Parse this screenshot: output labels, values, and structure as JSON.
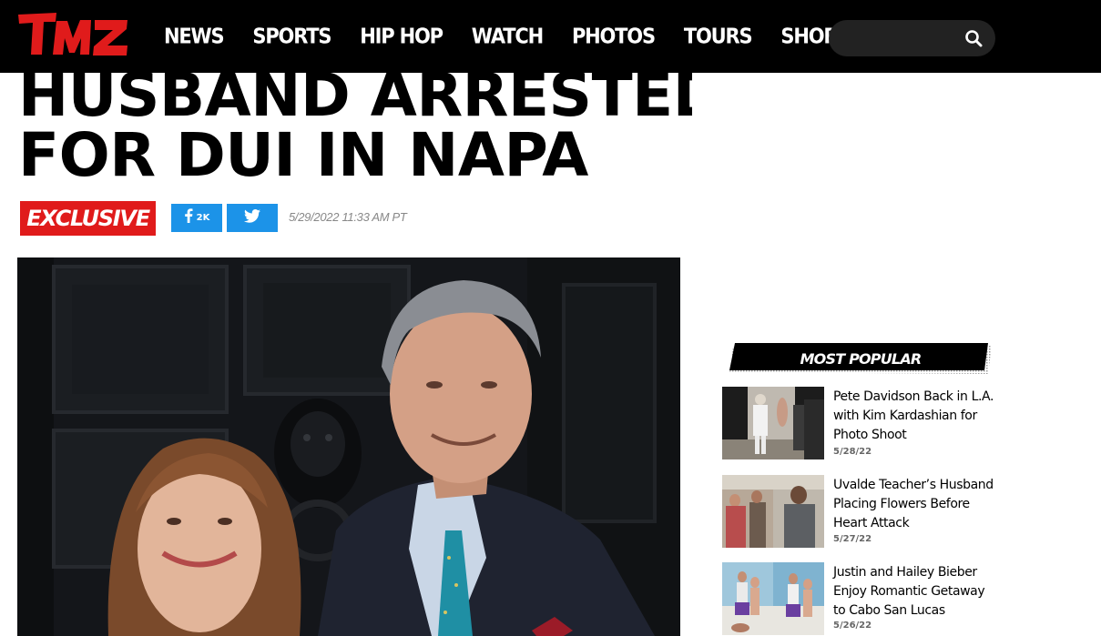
{
  "header": {
    "logo_text": "TMZ",
    "nav": [
      "NEWS",
      "SPORTS",
      "HIP HOP",
      "WATCH",
      "PHOTOS",
      "TOURS",
      "SHOP"
    ],
    "search": {
      "placeholder": "",
      "value": ""
    }
  },
  "article": {
    "headline_lines": [
      "HUSBAND ARRESTED",
      "FOR DUI IN NAPA"
    ],
    "badge": "EXCLUSIVE",
    "share": {
      "facebook_count": "2K"
    },
    "timestamp": "5/29/2022 11:33 AM PT"
  },
  "sidebar": {
    "most_popular_title": "MOST POPULAR",
    "items": [
      {
        "title": "Pete Davidson Back in L.A. with Kim Kardashian for Photo Shoot",
        "date": "5/28/22"
      },
      {
        "title": "Uvalde Teacher’s Husband Placing Flowers Before Heart Attack",
        "date": "5/27/22"
      },
      {
        "title": "Justin and Hailey Bieber Enjoy Romantic Getaway to Cabo San Lucas",
        "date": "5/26/22"
      }
    ]
  },
  "colors": {
    "header_bg": "#000000",
    "brand_red": "#e01b1b",
    "share_blue": "#1c93e8",
    "timestamp_gray": "#888888"
  },
  "icons": {
    "search": "search-icon",
    "facebook": "facebook-icon",
    "twitter": "twitter-icon"
  }
}
